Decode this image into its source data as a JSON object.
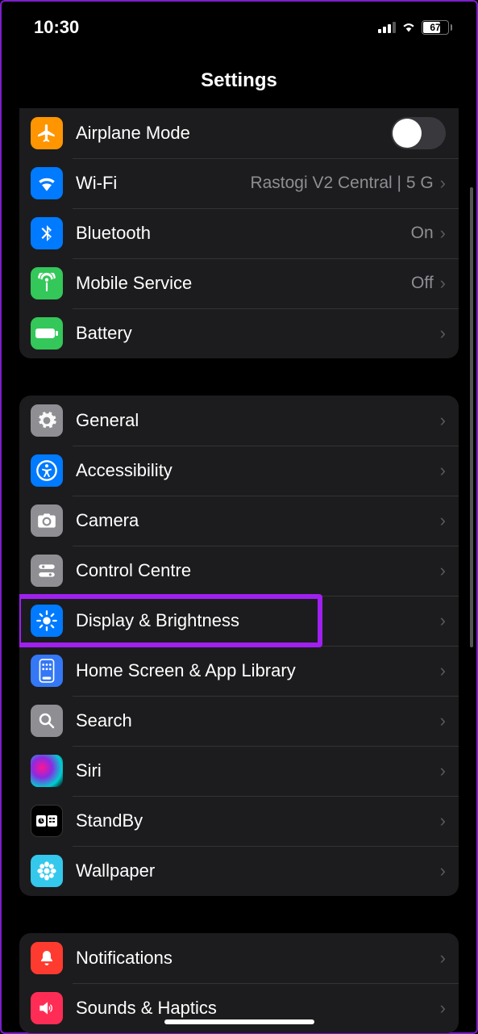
{
  "status": {
    "time": "10:30",
    "battery": "67"
  },
  "header": {
    "title": "Settings"
  },
  "group1": {
    "airplane": "Airplane Mode",
    "wifi": "Wi-Fi",
    "wifi_value": "Rastogi V2 Central |  5 G",
    "bluetooth": "Bluetooth",
    "bluetooth_value": "On",
    "mobile": "Mobile Service",
    "mobile_value": "Off",
    "battery": "Battery"
  },
  "group2": {
    "general": "General",
    "accessibility": "Accessibility",
    "camera": "Camera",
    "control": "Control Centre",
    "display": "Display & Brightness",
    "home": "Home Screen & App Library",
    "search": "Search",
    "siri": "Siri",
    "standby": "StandBy",
    "wallpaper": "Wallpaper"
  },
  "group3": {
    "notifications": "Notifications",
    "sounds": "Sounds & Haptics"
  }
}
